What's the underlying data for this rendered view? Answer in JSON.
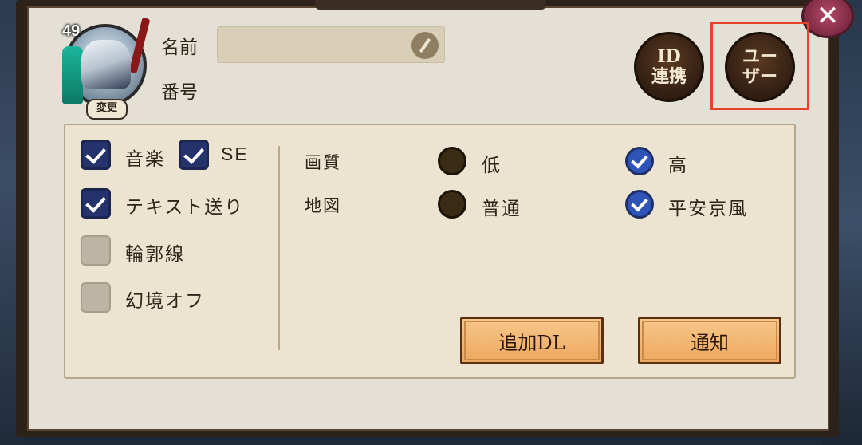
{
  "profile": {
    "level": "49",
    "change_label": "変更",
    "name_label": "名前",
    "number_label": "番号",
    "name_value": ""
  },
  "buttons": {
    "id_link_line1": "ID",
    "id_link_line2": "連携",
    "user_line1": "ユー",
    "user_line2": "ザー",
    "close": "✕"
  },
  "toggles": {
    "music": {
      "label": "音楽",
      "checked": true
    },
    "se": {
      "label": "SE",
      "checked": true
    },
    "text_send": {
      "label": "テキスト送り",
      "checked": true
    },
    "outline": {
      "label": "輪郭線",
      "checked": false
    },
    "illusion_off": {
      "label": "幻境オフ",
      "checked": false
    }
  },
  "quality": {
    "label": "画質",
    "options": [
      {
        "label": "低",
        "selected": false
      },
      {
        "label": "高",
        "selected": true
      }
    ]
  },
  "map": {
    "label": "地図",
    "options": [
      {
        "label": "普通",
        "selected": false
      },
      {
        "label": "平安京風",
        "selected": true
      }
    ]
  },
  "actions": {
    "additional_dl": "追加DL",
    "notify": "通知"
  },
  "colors": {
    "highlight": "#e8412a",
    "checkbox_on": "#24336c",
    "radio_on": "#2f54b8"
  }
}
